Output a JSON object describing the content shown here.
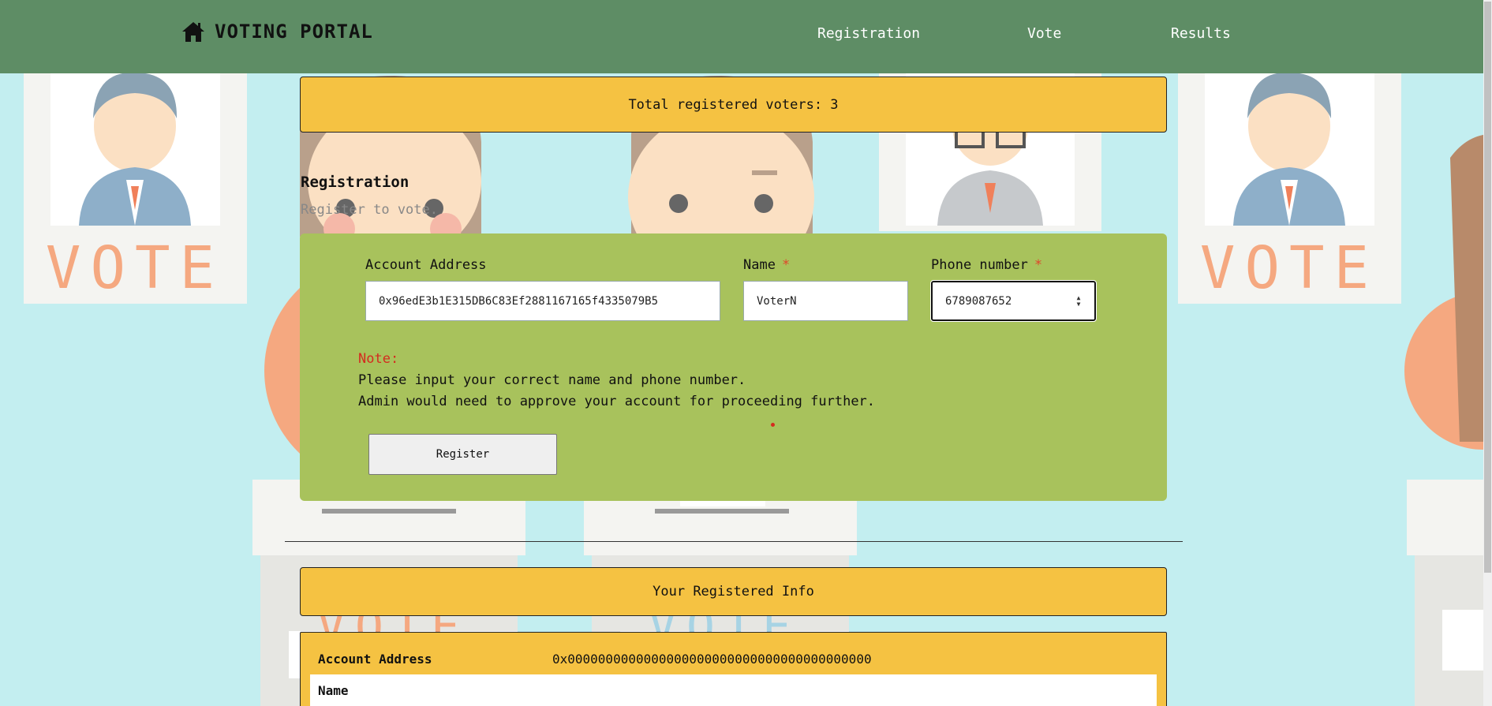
{
  "app": {
    "title": "VOTING PORTAL",
    "nav": [
      "Registration",
      "Vote",
      "Results"
    ]
  },
  "banner": {
    "total_voters": "Total registered voters: 3"
  },
  "registration": {
    "title": "Registration",
    "subtitle": "Register to vote.",
    "fields": {
      "account_label": "Account Address",
      "account_value": "0x96edE3b1E315DB6C83Ef2881167165f4335079B5",
      "name_label": "Name",
      "name_value": "VoterN",
      "phone_label": "Phone number",
      "phone_value": "6789087652",
      "required_mark": "*"
    },
    "note": {
      "label": "Note:",
      "line1": "Please input your correct name and phone number.",
      "line2": "Admin would need to approve your account for proceeding further."
    },
    "register_button": "Register"
  },
  "registered_info": {
    "title": "Your Registered Info",
    "account_label": "Account Address",
    "account_value": "0x0000000000000000000000000000000000000000",
    "name_label": "Name"
  },
  "background": {
    "poster_text": "VOTE"
  },
  "colors": {
    "navbar": "#5e8d65",
    "banner": "#f5c242",
    "panel": "#a8c25c",
    "background": "#c3eef0",
    "note": "#d42b1f"
  }
}
